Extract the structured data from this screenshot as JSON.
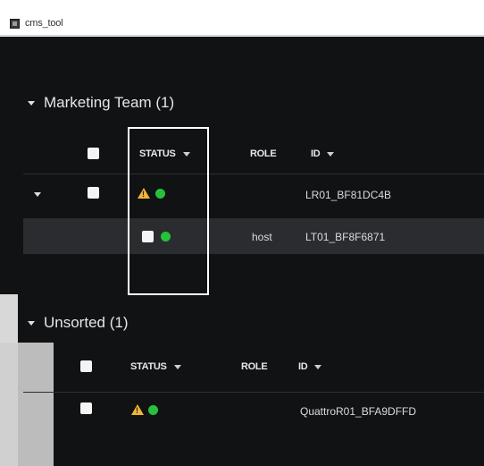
{
  "window": {
    "title": "cms_tool"
  },
  "groups": [
    {
      "name": "Marketing Team (1)",
      "columns": {
        "status": "STATUS",
        "role": "ROLE",
        "id": "ID"
      },
      "rows": [
        {
          "role": "",
          "id": "LR01_BF81DC4B",
          "status_icons": [
            "warning-icon",
            "online-dot-icon"
          ]
        },
        {
          "role": "host",
          "id": "LT01_BF8F6871",
          "status_icons": [
            "status-checkbox-icon",
            "online-dot-icon"
          ]
        }
      ]
    },
    {
      "name": "Unsorted (1)",
      "columns": {
        "status": "STATUS",
        "role": "ROLE",
        "id": "ID"
      },
      "rows": [
        {
          "role": "",
          "id": "QuattroR01_BFA9DFFD",
          "status_icons": [
            "warning-icon",
            "online-dot-icon"
          ]
        }
      ]
    }
  ],
  "colors": {
    "background": "#111214",
    "selected_row": "#2b2c30",
    "warning": "#f2b632",
    "online": "#27c23b"
  }
}
